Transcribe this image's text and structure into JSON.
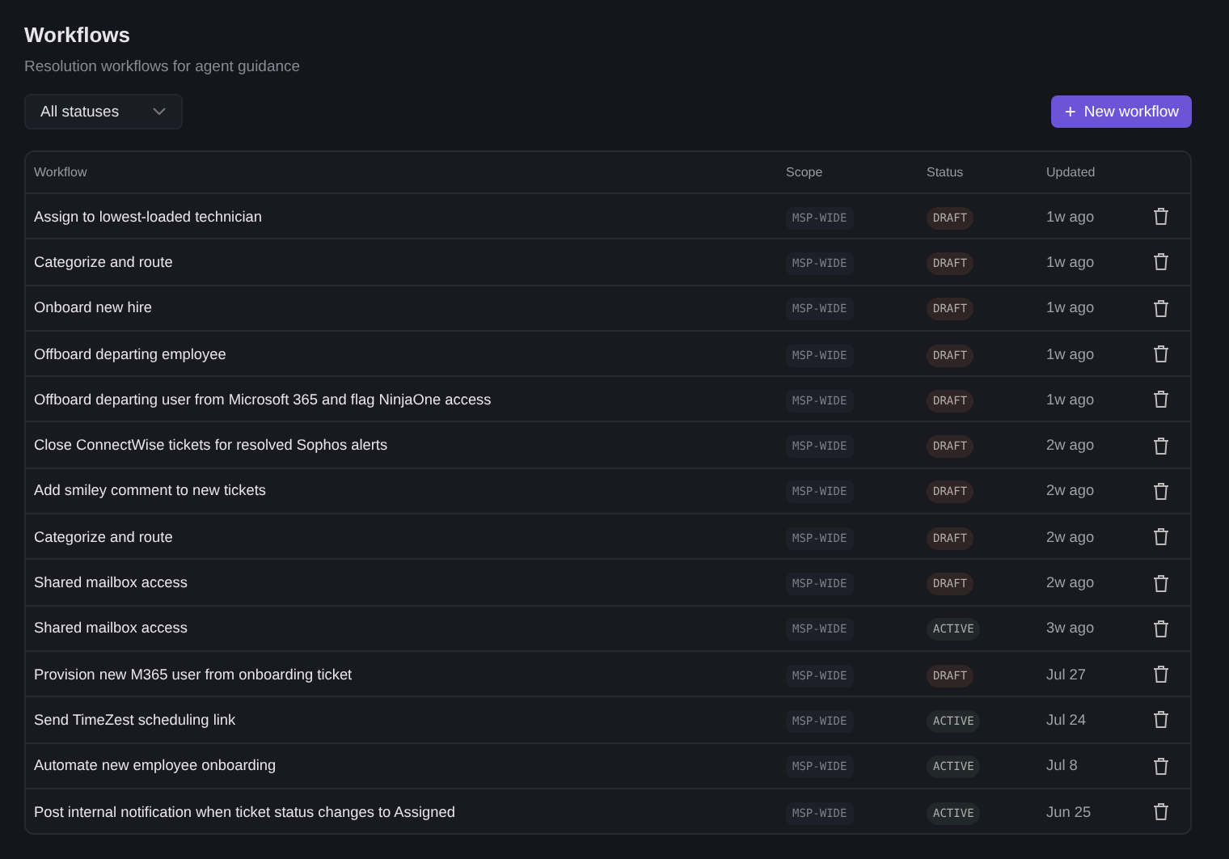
{
  "header": {
    "title": "Workflows",
    "subtitle": "Resolution workflows for agent guidance"
  },
  "filter": {
    "value": "All statuses"
  },
  "new_button": {
    "label": "New workflow",
    "icon": "+"
  },
  "table": {
    "columns": [
      "Workflow",
      "Scope",
      "Status",
      "Updated"
    ],
    "rows": [
      {
        "workflow": "Assign to lowest-loaded technician",
        "scope": "MSP-WIDE",
        "status": "DRAFT",
        "color": "#2e2524",
        "updated": "1w ago"
      },
      {
        "workflow": "Categorize and route",
        "scope": "MSP-WIDE",
        "status": "DRAFT",
        "color": "#2e2524",
        "updated": "1w ago"
      },
      {
        "workflow": "Onboard new hire",
        "scope": "MSP-WIDE",
        "status": "DRAFT",
        "color": "#2e2524",
        "updated": "1w ago"
      },
      {
        "workflow": "Offboard departing employee",
        "scope": "MSP-WIDE",
        "status": "DRAFT",
        "color": "#2e2524",
        "updated": "1w ago"
      },
      {
        "workflow": "Offboard departing user from Microsoft 365 and flag NinjaOne access",
        "scope": "MSP-WIDE",
        "status": "DRAFT",
        "color": "#2e2524",
        "updated": "1w ago"
      },
      {
        "workflow": "Close ConnectWise tickets for resolved Sophos alerts",
        "scope": "MSP-WIDE",
        "status": "DRAFT",
        "color": "#2e2524",
        "updated": "2w ago"
      },
      {
        "workflow": "Add smiley comment to new tickets",
        "scope": "MSP-WIDE",
        "status": "DRAFT",
        "color": "#2e2524",
        "updated": "2w ago"
      },
      {
        "workflow": "Categorize and route",
        "scope": "MSP-WIDE",
        "status": "DRAFT",
        "color": "#2e2524",
        "updated": "2w ago"
      },
      {
        "workflow": "Shared mailbox access",
        "scope": "MSP-WIDE",
        "status": "DRAFT",
        "color": "#2e2524",
        "updated": "2w ago"
      },
      {
        "workflow": "Shared mailbox access",
        "scope": "MSP-WIDE",
        "status": "ACTIVE",
        "color": "#22272a",
        "updated": "3w ago"
      },
      {
        "workflow": "Provision new M365 user from onboarding ticket",
        "scope": "MSP-WIDE",
        "status": "DRAFT",
        "color": "#2e2524",
        "updated": "Jul 27"
      },
      {
        "workflow": "Send TimeZest scheduling link",
        "scope": "MSP-WIDE",
        "status": "ACTIVE",
        "color": "#22272a",
        "updated": "Jul 24"
      },
      {
        "workflow": "Automate new employee onboarding",
        "scope": "MSP-WIDE",
        "status": "ACTIVE",
        "color": "#22272a",
        "updated": "Jul 8"
      },
      {
        "workflow": "Post internal notification when ticket status changes to Assigned",
        "scope": "MSP-WIDE",
        "status": "ACTIVE",
        "color": "#22272a",
        "updated": "Jun 25"
      }
    ]
  }
}
